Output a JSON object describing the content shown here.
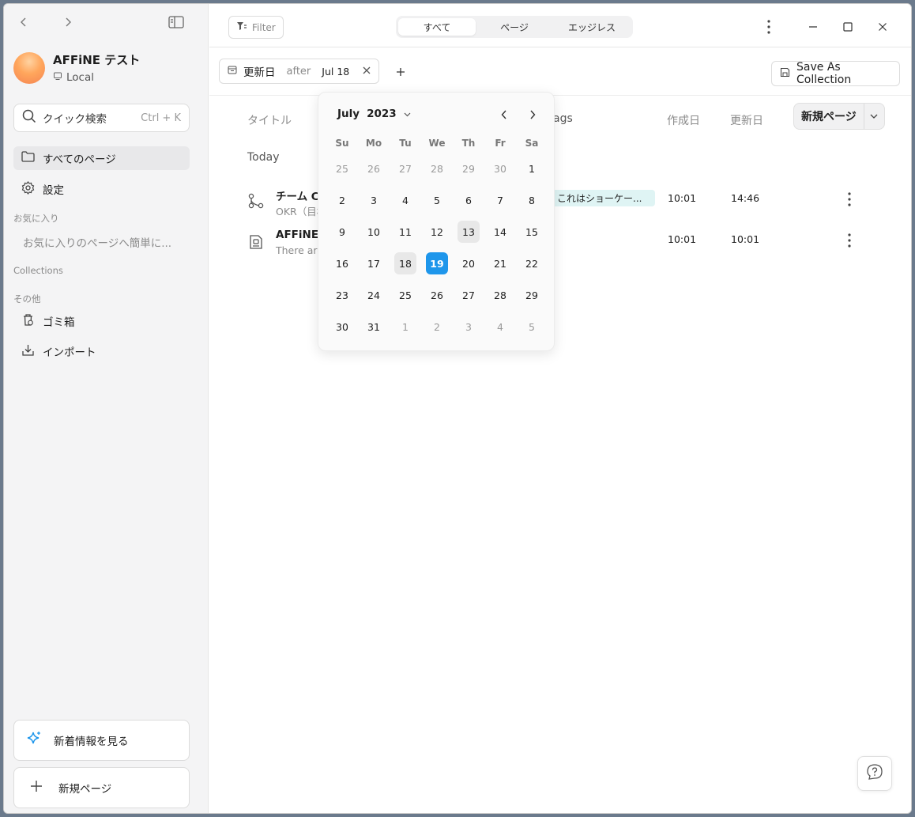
{
  "sidebar": {
    "workspace_name": "AFFiNE テスト",
    "workspace_type": "Local",
    "quick_search": "クイック検索",
    "quick_search_shortcut": "Ctrl + K",
    "nav": [
      {
        "label": "すべてのページ",
        "icon": "folder-icon",
        "active": true
      },
      {
        "label": "設定",
        "icon": "gear-icon",
        "active": false
      }
    ],
    "favorites_label": "お気に入り",
    "favorites_placeholder": "お気に入りのページへ簡単に...",
    "collections_label": "Collections",
    "others_label": "その他",
    "others": [
      {
        "label": "ゴミ箱",
        "icon": "trash-icon"
      },
      {
        "label": "インポート",
        "icon": "import-icon"
      }
    ],
    "whats_new": "新着情報を見る",
    "new_page": "新規ページ"
  },
  "topbar": {
    "filter_label": "Filter",
    "tabs": [
      {
        "label": "すべて",
        "active": true
      },
      {
        "label": "ページ",
        "active": false
      },
      {
        "label": "エッジレス",
        "active": false
      }
    ]
  },
  "filterbar": {
    "field": "更新日",
    "condition": "after",
    "value": "Jul 18",
    "save_as_collection": "Save As Collection"
  },
  "table": {
    "headers": {
      "title": "タイトル",
      "tags": "ags",
      "created": "作成日",
      "updated": "更新日"
    },
    "new_page": "新規ページ",
    "group": "Today",
    "rows": [
      {
        "title": "チーム C",
        "preview": "OKR（目標",
        "tag": "これはショーケー...",
        "created": "10:01",
        "updated": "14:46",
        "icon": "branch-icon"
      },
      {
        "title": "AFFiNE",
        "preview": "There are",
        "tag": "",
        "created": "10:01",
        "updated": "10:01",
        "icon": "page-icon"
      }
    ]
  },
  "calendar": {
    "month": "July",
    "year": "2023",
    "weekdays": [
      "Su",
      "Mo",
      "Tu",
      "We",
      "Th",
      "Fr",
      "Sa"
    ],
    "days": [
      {
        "d": "25",
        "m": true
      },
      {
        "d": "26",
        "m": true
      },
      {
        "d": "27",
        "m": true
      },
      {
        "d": "28",
        "m": true
      },
      {
        "d": "29",
        "m": true
      },
      {
        "d": "30",
        "m": true
      },
      {
        "d": "1"
      },
      {
        "d": "2"
      },
      {
        "d": "3"
      },
      {
        "d": "4"
      },
      {
        "d": "5"
      },
      {
        "d": "6"
      },
      {
        "d": "7"
      },
      {
        "d": "8"
      },
      {
        "d": "9"
      },
      {
        "d": "10"
      },
      {
        "d": "11"
      },
      {
        "d": "12"
      },
      {
        "d": "13",
        "s": "today"
      },
      {
        "d": "14"
      },
      {
        "d": "15"
      },
      {
        "d": "16"
      },
      {
        "d": "17"
      },
      {
        "d": "18",
        "s": "hover"
      },
      {
        "d": "19",
        "s": "selected"
      },
      {
        "d": "20"
      },
      {
        "d": "21"
      },
      {
        "d": "22"
      },
      {
        "d": "23"
      },
      {
        "d": "24"
      },
      {
        "d": "25"
      },
      {
        "d": "26"
      },
      {
        "d": "27"
      },
      {
        "d": "28"
      },
      {
        "d": "29"
      },
      {
        "d": "30"
      },
      {
        "d": "31"
      },
      {
        "d": "1",
        "m": true
      },
      {
        "d": "2",
        "m": true
      },
      {
        "d": "3",
        "m": true
      },
      {
        "d": "4",
        "m": true
      },
      {
        "d": "5",
        "m": true
      }
    ]
  },
  "colors": {
    "accent": "#1e96eb",
    "tag_bg": "#dff4f4",
    "sidebar_bg": "#f4f4f5"
  }
}
